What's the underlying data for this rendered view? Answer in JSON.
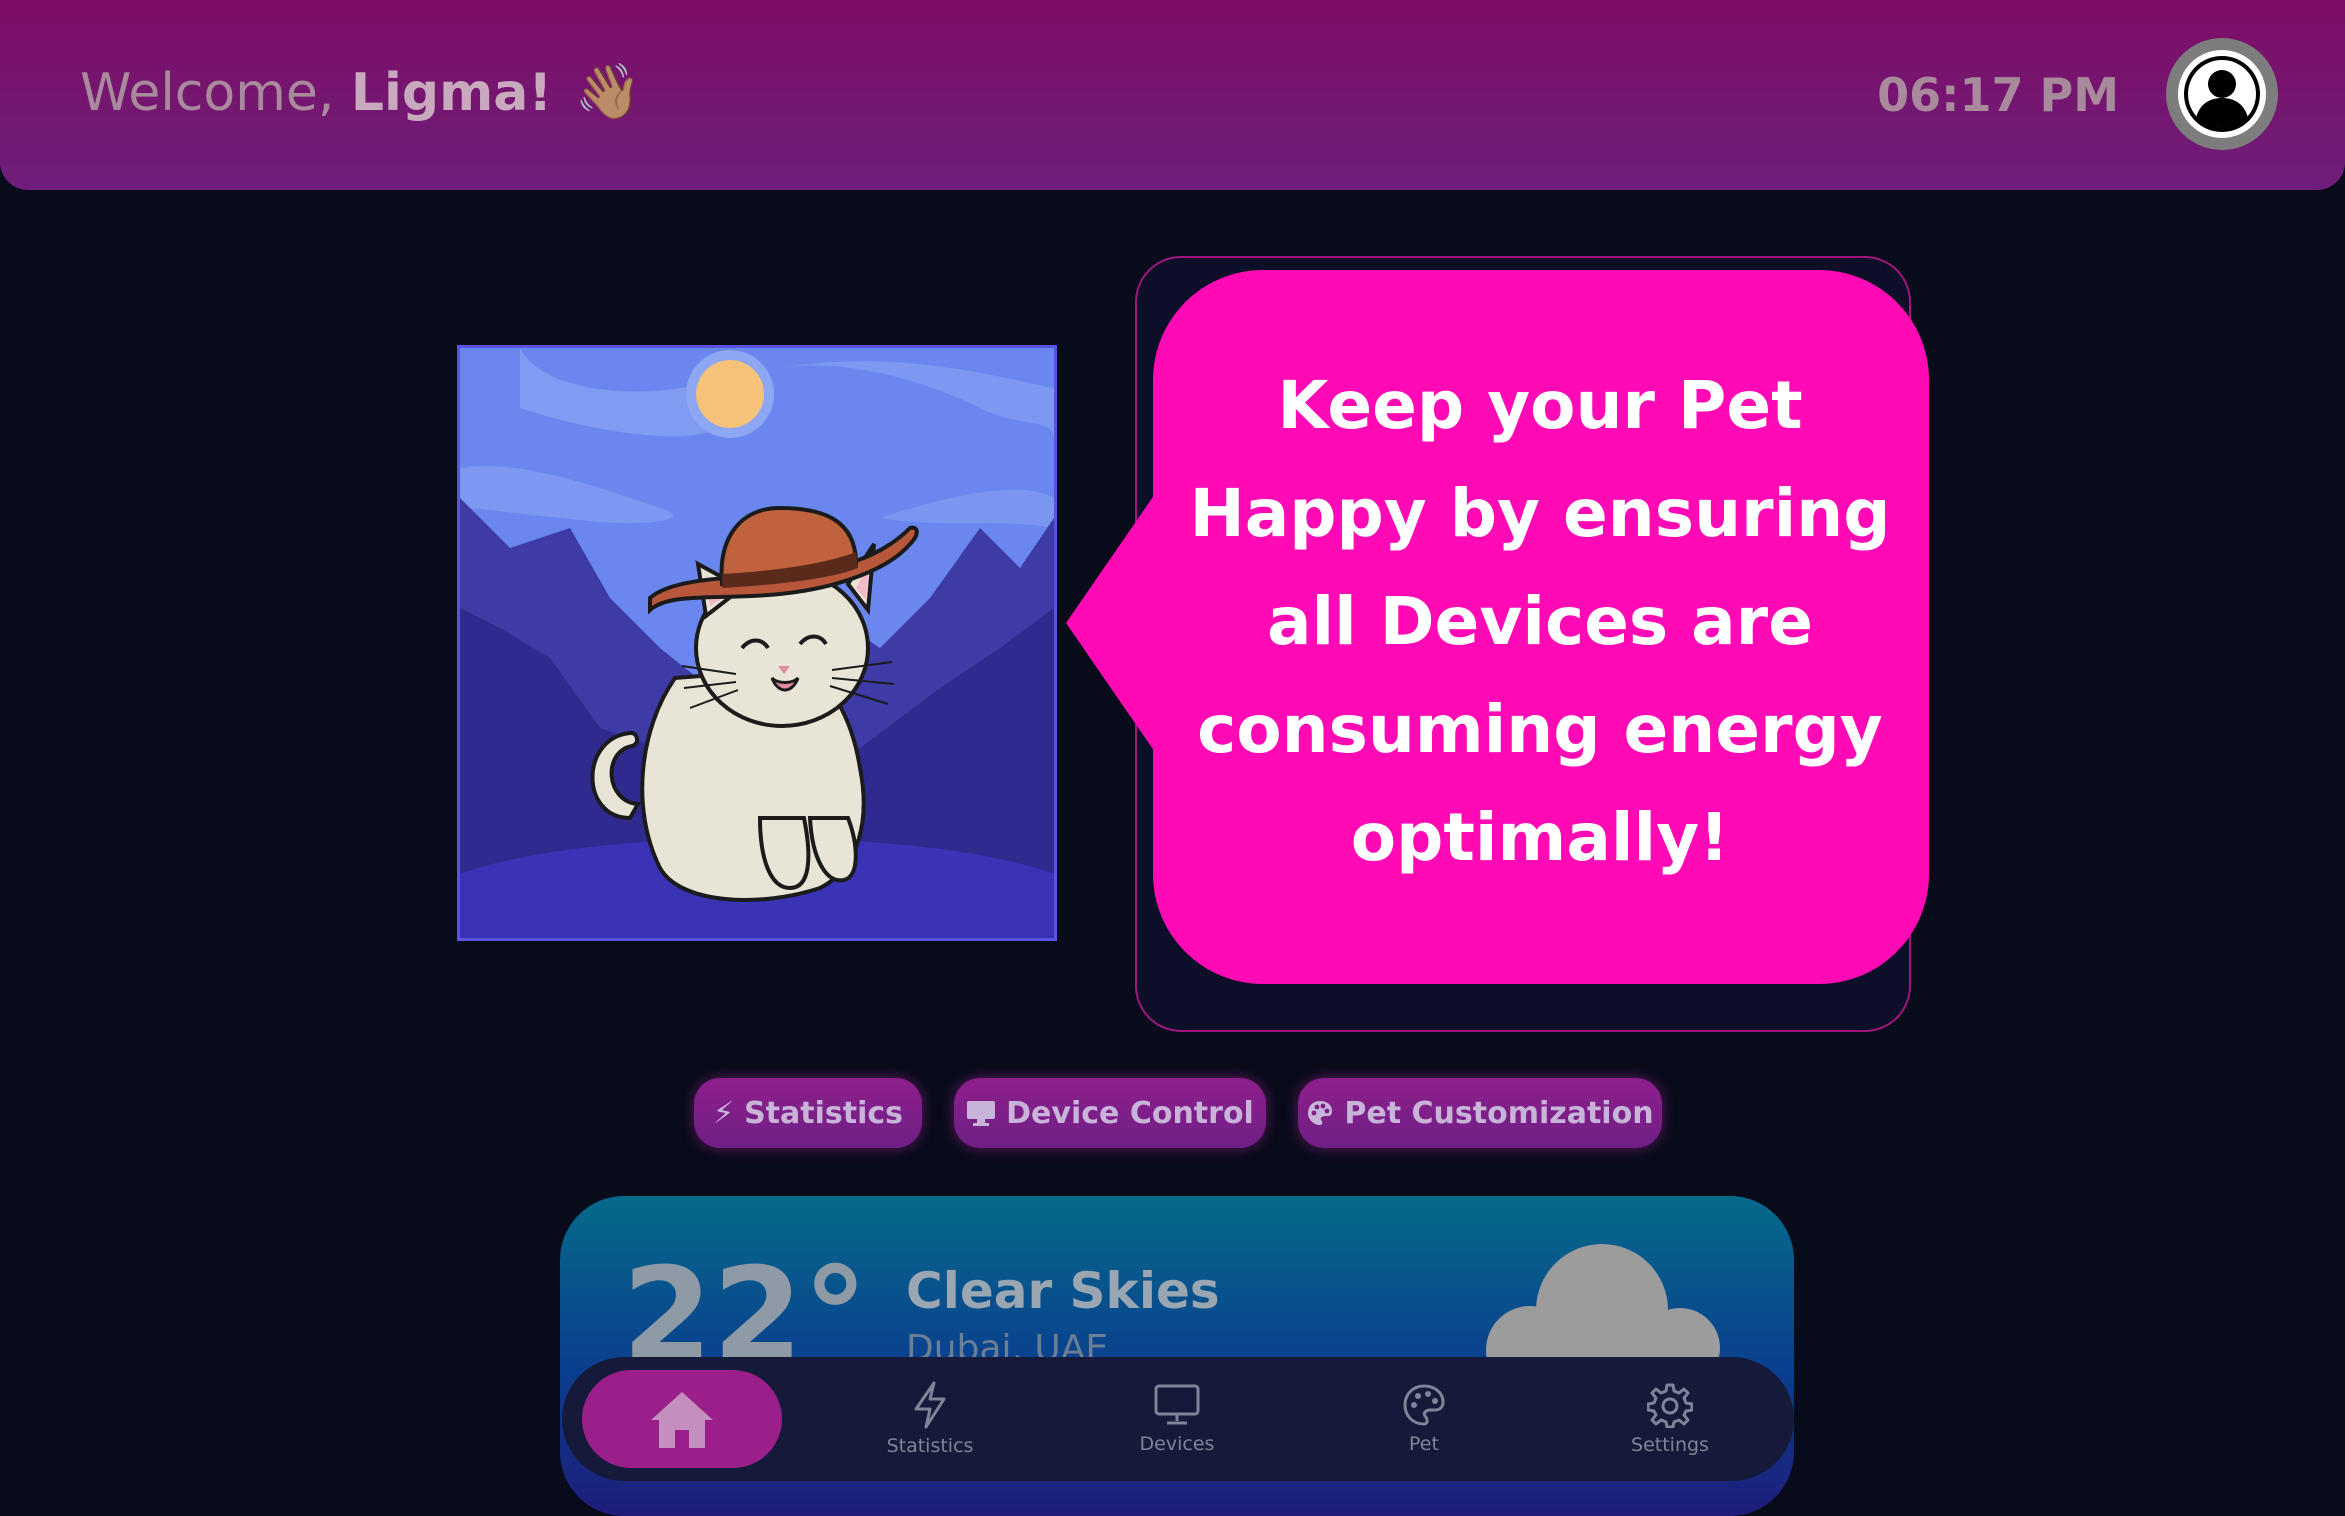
{
  "header": {
    "welcome_prefix": "Welcome, ",
    "user_name": "Ligma!",
    "wave_emoji": "👋🏽",
    "time": "06:17 PM",
    "avatar_icon": "user-circle-icon"
  },
  "pet": {
    "image_icon": "cowboy-cat-pet-image",
    "message": "Keep your Pet Happy by ensuring all Devices are consuming energy optimally!"
  },
  "actions": [
    {
      "label": "Statistics",
      "icon": "bolt-icon"
    },
    {
      "label": "Device Control",
      "icon": "monitor-icon"
    },
    {
      "label": "Pet Customization",
      "icon": "palette-icon"
    }
  ],
  "weather": {
    "temperature": "22°",
    "condition": "Clear Skies",
    "location": "Dubai, UAE",
    "icon": "cloud-icon"
  },
  "nav": [
    {
      "label": "",
      "icon": "home-icon",
      "active": true
    },
    {
      "label": "Statistics",
      "icon": "bolt-icon"
    },
    {
      "label": "Devices",
      "icon": "monitor-icon"
    },
    {
      "label": "Pet",
      "icon": "palette-icon"
    },
    {
      "label": "Settings",
      "icon": "gear-icon"
    }
  ],
  "colors": {
    "background": "#080b1a",
    "header": "#7d0d66",
    "bubble": "#ff0ab4",
    "accent": "#9a1f8a"
  }
}
